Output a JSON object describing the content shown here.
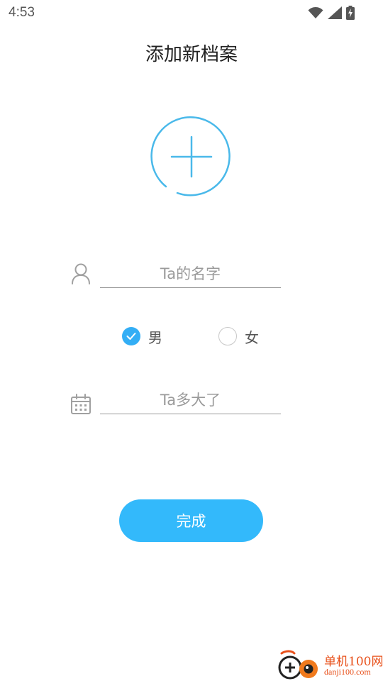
{
  "status_bar": {
    "time": "4:53",
    "icons": [
      "wifi-icon",
      "signal-icon",
      "battery-charging-icon"
    ]
  },
  "header": {
    "title": "添加新档案"
  },
  "avatar": {
    "icon": "plus-icon",
    "accent_color": "#4ab9ea"
  },
  "form": {
    "name_placeholder": "Ta的名字",
    "name_value": "",
    "gender": {
      "options": [
        {
          "label": "男",
          "checked": true
        },
        {
          "label": "女",
          "checked": false
        }
      ]
    },
    "age_placeholder": "Ta多大了",
    "age_value": ""
  },
  "actions": {
    "done_label": "完成",
    "done_color": "#33b9fb"
  },
  "watermark": {
    "brand": "单机100网",
    "domain": "danji100.com"
  }
}
